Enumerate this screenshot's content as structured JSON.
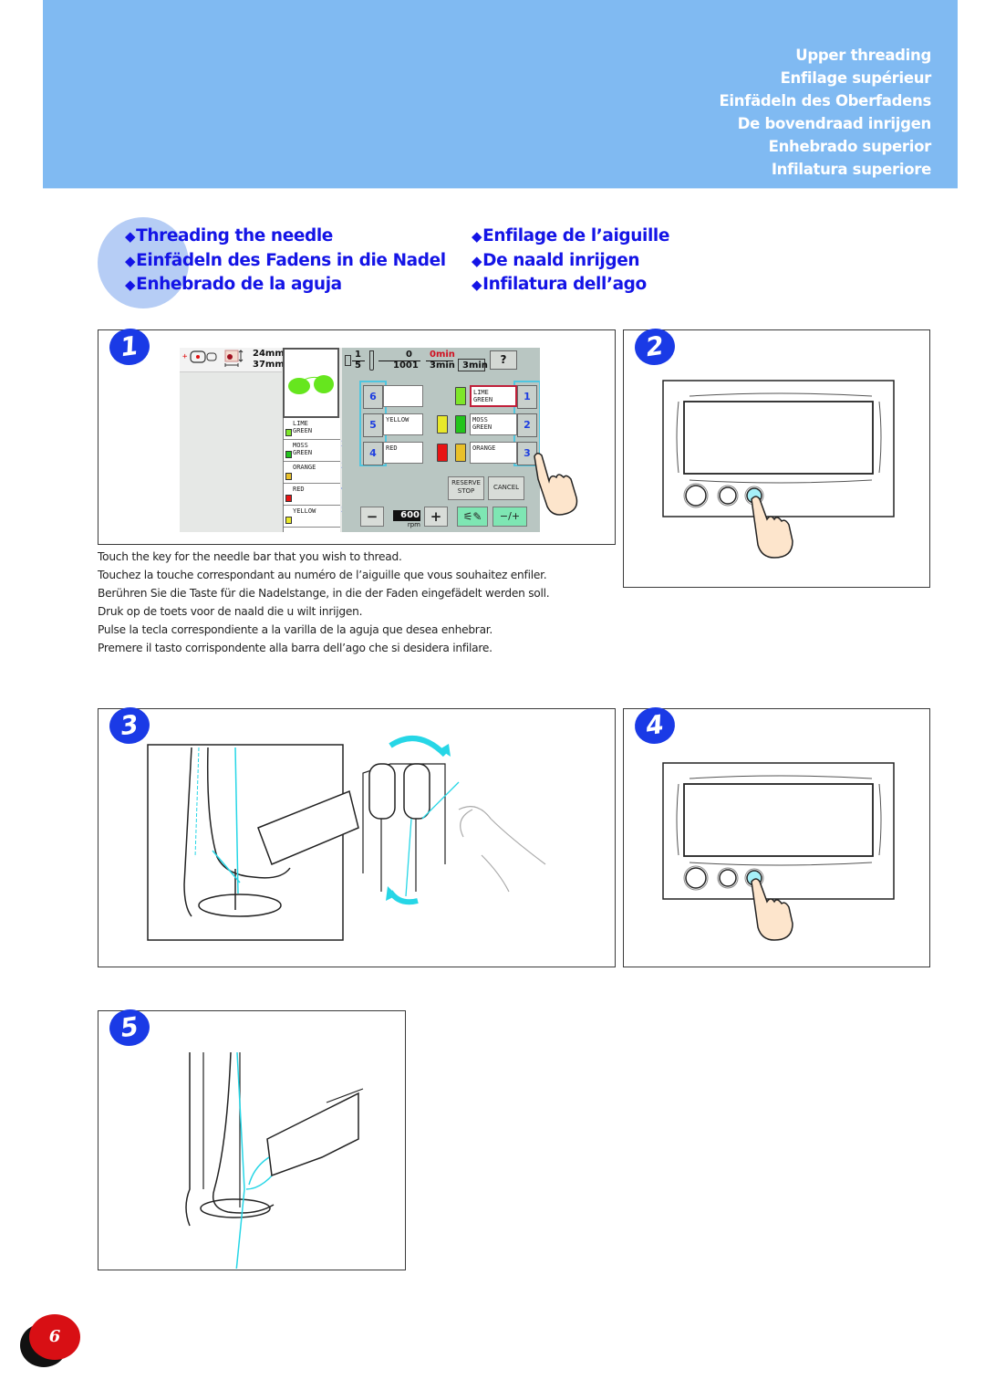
{
  "header": {
    "titles": [
      "Upper threading",
      "Enfilage supérieur",
      "Einfädeln des Oberfadens",
      "De bovendraad inrijgen",
      "Enhebrado superior",
      "Infilatura superiore"
    ],
    "band_color": "#80baf2"
  },
  "subheadings": {
    "bullet": "◆",
    "left": [
      "Threading the needle",
      "Einfädeln des Fadens in die Nadel",
      "Enhebrado de la aguja"
    ],
    "right": [
      "Enfilage de l’aiguille",
      "De naald inrijgen",
      "Infilatura dell’ago"
    ],
    "color": "#1414e6"
  },
  "steps": [
    {
      "number": "1",
      "illustration": "touch-panel-needle-bar-keys"
    },
    {
      "number": "2",
      "illustration": "press-button-on-panel"
    },
    {
      "number": "3",
      "illustration": "thread-guide-rotation"
    },
    {
      "number": "4",
      "illustration": "press-button-on-panel"
    },
    {
      "number": "5",
      "illustration": "needle-threader-hook"
    }
  ],
  "step1_caption": [
    "Touch the key for the needle bar that you wish to thread.",
    "Touchez la touche correspondant au numéro de l’aiguille que vous souhaitez enfiler.",
    "Berühren Sie die Taste für die Nadelstange, in die der Faden eingefädelt werden soll.",
    "Druk op de toets voor de naald die u wilt inrijgen.",
    "Pulse la tecla correspondiente a la varilla de la aguja que desea enhebrar.",
    "Premere il tasto corrispondente alla barra dell’ago che si desidera infilare."
  ],
  "lcd": {
    "height": "24mm",
    "width": "37mm",
    "color_sequence": [
      {
        "name": "LIME\nGREEN",
        "needle": "1",
        "color": "#7ee62a"
      },
      {
        "name": "MOSS\nGREEN",
        "needle": "2",
        "color": "#22c41c"
      },
      {
        "name": "ORANGE",
        "needle": "3",
        "color": "#e8c02a"
      },
      {
        "name": "RED",
        "needle": "4",
        "color": "#e81414"
      },
      {
        "name": "YELLOW",
        "needle": "5",
        "color": "#e8e82a"
      }
    ],
    "status": {
      "color_fraction_top": "1",
      "color_fraction_bottom": "5",
      "stitch_top": "0",
      "stitch_bottom": "1001",
      "time_top": "0min",
      "time_bottom": "3min",
      "time_total": "3min"
    },
    "needle_keys_left": [
      "6",
      "5",
      "4"
    ],
    "needle_keys_right": [
      "1",
      "2",
      "3"
    ],
    "thread_fields_left": [
      "",
      "YELLOW",
      "RED"
    ],
    "thread_fields_right": [
      "LIME\nGREEN",
      "MOSS\nGREEN",
      "ORANGE"
    ],
    "buttons": {
      "reserve_stop": "RESERVE\nSTOP",
      "cancel": "CANCEL",
      "minus": "−",
      "plus": "+",
      "needle_plus_minus": "−/+"
    },
    "speed_value": "600",
    "speed_unit": "rpm",
    "highlight_color": "#4fc6e0",
    "selected_border_color": "#c0203a"
  },
  "page_number": "6"
}
